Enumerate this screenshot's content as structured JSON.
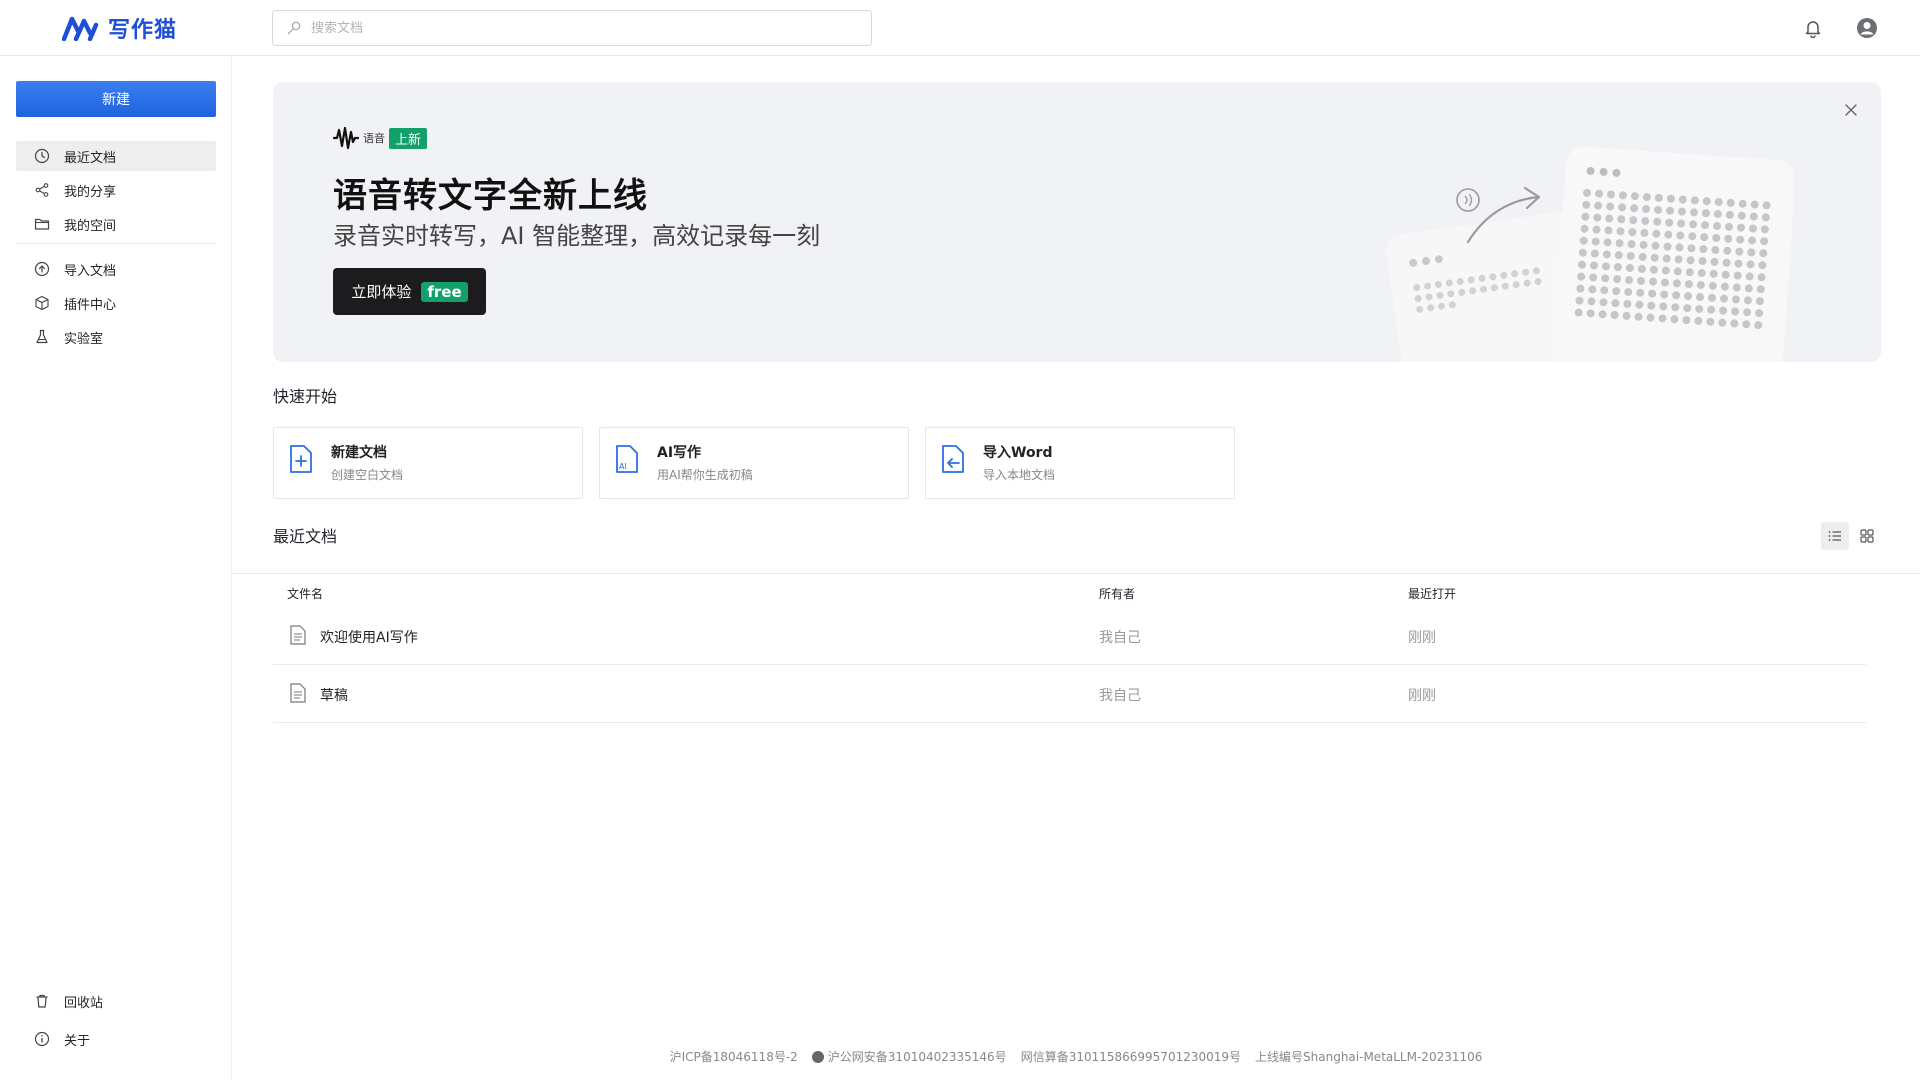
{
  "app": {
    "logo_text": "写作猫",
    "search_placeholder": "搜索文档"
  },
  "sidebar": {
    "new_button": "新建",
    "items": [
      {
        "label": "最近文档",
        "icon": "clock-icon"
      },
      {
        "label": "我的分享",
        "icon": "share-icon"
      },
      {
        "label": "我的空间",
        "icon": "folder-icon"
      },
      {
        "label": "导入文档",
        "icon": "upload-icon"
      },
      {
        "label": "插件中心",
        "icon": "cube-icon"
      },
      {
        "label": "实验室",
        "icon": "flask-icon"
      }
    ],
    "bottom_items": [
      {
        "label": "回收站",
        "icon": "trash-icon"
      },
      {
        "label": "关于",
        "icon": "info-icon"
      }
    ]
  },
  "banner": {
    "tag_small": "语音",
    "tag_badge": "上新",
    "title": "语音转文字全新上线",
    "subtitle": "录音实时转写，AI 智能整理，高效记录每一刻",
    "button_label": "立即体验",
    "button_badge": "free"
  },
  "quick_start": {
    "title": "快速开始",
    "cards": [
      {
        "title": "新建文档",
        "desc": "创建空白文档",
        "icon": "file-plus-icon"
      },
      {
        "title": "AI写作",
        "desc": "用AI帮你生成初稿",
        "icon": "ai-file-icon"
      },
      {
        "title": "导入Word",
        "desc": "导入本地文档",
        "icon": "file-import-icon"
      }
    ]
  },
  "recent": {
    "title": "最近文档",
    "columns": [
      "文件名",
      "所有者",
      "最近打开"
    ],
    "rows": [
      {
        "name": "欢迎使用AI写作",
        "owner": "我自己",
        "time": "刚刚"
      },
      {
        "name": "草稿",
        "owner": "我自己",
        "time": "刚刚"
      }
    ]
  },
  "footer": {
    "icp": "沪ICP备18046118号-2",
    "police": "沪公网安备31010402335146号",
    "algo": "网信算备310115866995701230019号",
    "model": "上线编号Shanghai-MetaLLM-20231106"
  }
}
